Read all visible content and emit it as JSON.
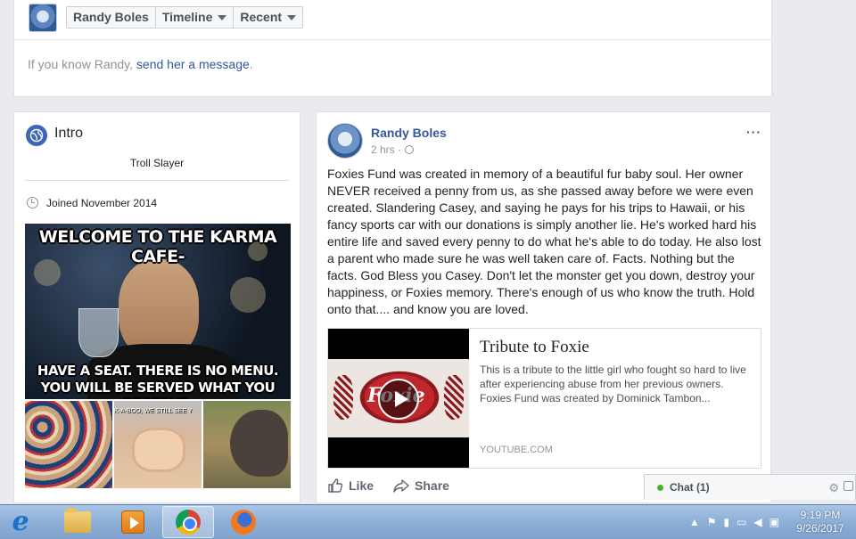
{
  "profile_nav": {
    "name_button": "Randy Boles",
    "timeline_button": "Timeline",
    "recent_button": "Recent",
    "know_text": "If you know Randy, ",
    "know_link": "send her a message",
    "know_end": "."
  },
  "intro": {
    "title": "Intro",
    "bio": "Troll Slayer",
    "joined": "Joined November 2014",
    "meme_top": "WELCOME TO THE KARMA CAFE-",
    "meme_bottom_1": "HAVE A SEAT. THERE IS NO MENU.",
    "meme_bottom_2": "YOU WILL BE SERVED WHAT YOU DESERVE.",
    "thumb_caption": "K-A-BOO, WE STILL SEE Y"
  },
  "post": {
    "author": "Randy Boles",
    "time": "2 hrs ·",
    "more": "···",
    "text": "Foxies Fund was created in memory of a beautiful fur baby soul. Her owner NEVER received a penny from us, as she passed away before we were even created. Slandering Casey, and saying he pays for his trips to Hawaii, or his fancy sports car with our donations is simply another lie. He's worked hard his entire life and saved every penny to do what he's able to do today. He also lost a parent who made sure he was well taken care of. Facts. Nothing but the facts. God Bless you Casey. Don't let the monster get you down, destroy your happiness, or Foxies memory. There's enough of us who know the truth. Hold onto that.... and know you are loved.",
    "share": {
      "title": "Tribute to Foxie",
      "description": "This is a tribute to the little girl who fought so hard to live after experiencing abuse from her previous owners. Foxies Fund was created by Dominick Tambon...",
      "domain": "YOUTUBE.COM",
      "thumb_text": "Foxie"
    },
    "like_label": "Like",
    "share_label": "Share"
  },
  "chat": {
    "label": "Chat (1)"
  },
  "taskbar": {
    "time": "9:19 PM",
    "date": "9/26/2017"
  },
  "colors": {
    "link": "#365899",
    "facebook_blue": "#4267b2",
    "online_green": "#42b72a"
  }
}
